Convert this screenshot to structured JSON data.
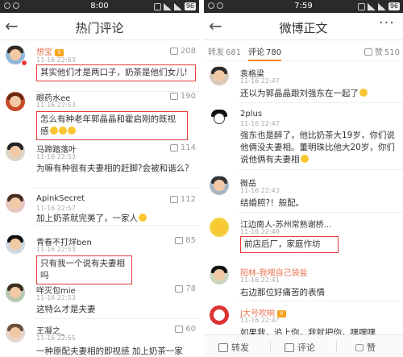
{
  "left": {
    "status": {
      "time": "8:00",
      "battery": "96"
    },
    "title": "热门评论",
    "comments": [
      {
        "name": "想宝",
        "date": "11-16 22:53",
        "likes": "208",
        "text": "其实他们才是两口子，奶茶是他们女儿!",
        "highlight": true
      },
      {
        "name": "眼药水ee",
        "date": "11-16 22:53",
        "likes": "190",
        "text": "怎么有种老年郭晶晶和霍启刚的既视感",
        "highlight": true
      },
      {
        "name": "马蹄踏落叶",
        "date": "11-16 22:53",
        "likes": "114",
        "text": "为嘛有种很有夫妻相的赶脚?会被和谐么?"
      },
      {
        "name": "ApinkSecret",
        "date": "11-16 22:57",
        "likes": "112",
        "text": "加上奶茶就完美了，一家人"
      },
      {
        "name": "青春不打烊ben",
        "date": "11-16 22:53",
        "likes": "85",
        "text": "只有我一个说有夫妻相吗",
        "highlight": true
      },
      {
        "name": "咩灭包mie",
        "date": "11-16 22:53",
        "likes": "78",
        "text": "这特么才是夫妻"
      },
      {
        "name": "王凝之_",
        "date": "11-16 22:55",
        "likes": "60",
        "text": "一种原配夫妻相的即视感 加上奶茶一家"
      }
    ]
  },
  "right": {
    "status": {
      "time": "7:59",
      "battery": "96"
    },
    "title": "微博正文",
    "more": "···",
    "tabs": {
      "repost_label": "转发",
      "repost_count": "681",
      "comment_label": "评论",
      "comment_count": "780",
      "like_label": "赞",
      "like_count": "510"
    },
    "comments": [
      {
        "name": "袁格梁",
        "date": "11-16 22:47",
        "text": "还以为郭晶晶跟刘强东在一起了"
      },
      {
        "name": "2plus",
        "date": "11-16 22:47",
        "text": "强东也是醉了，他比奶茶大19岁，你们说他俩没夫妻相。董明珠比他大20岁，你们说他俩有夫妻相"
      },
      {
        "name": "微岳",
        "date": "11-16 22:43",
        "text": "结婚照?！般配。"
      },
      {
        "name": "江边南人-苏州常熟谢桥...",
        "date": "11-16 22:40",
        "text": "前店后厂，家庭作坊",
        "highlight": true
      },
      {
        "name": "阳林-我喂自己袋盐",
        "date": "11-16 22:41",
        "text": "右边那位好痛苦的表情"
      },
      {
        "name": "J大号吹晌",
        "date": "11-16 22:4?",
        "text": "如果我，追上你，我就把你，嘿嘿嘿"
      }
    ],
    "bottom": {
      "repost": "转发",
      "comment": "评论",
      "like": "赞"
    }
  }
}
